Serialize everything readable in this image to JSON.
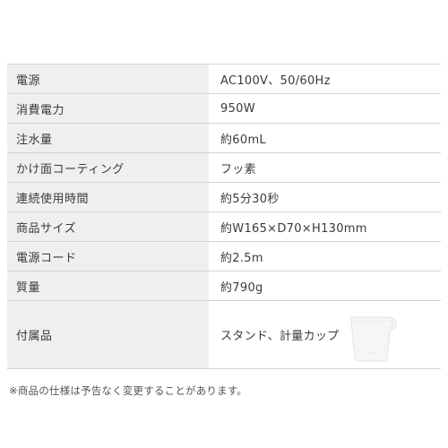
{
  "specs": [
    {
      "label": "電源",
      "value": "AC100V、50/60Hz"
    },
    {
      "label": "消費電力",
      "value": "950W"
    },
    {
      "label": "注水量",
      "value": "約60mL"
    },
    {
      "label": "かけ面コーティング",
      "value": "フッ素"
    },
    {
      "label": "連続使用時間",
      "value": "約5分30秒"
    },
    {
      "label": "商品サイズ",
      "value": "約W165×D70×H130mm"
    },
    {
      "label": "電源コード",
      "value": "約2.5m"
    },
    {
      "label": "質量",
      "value": "約790g"
    },
    {
      "label": "付属品",
      "value": "スタンド、計量カップ",
      "icon": "measuring-cup-icon"
    }
  ],
  "footnote": "※商品の仕様は予告なく変更することがあります。",
  "colors": {
    "label_bg": "#efefef",
    "border": "#d4d4d4",
    "text": "#3a3a3a"
  }
}
